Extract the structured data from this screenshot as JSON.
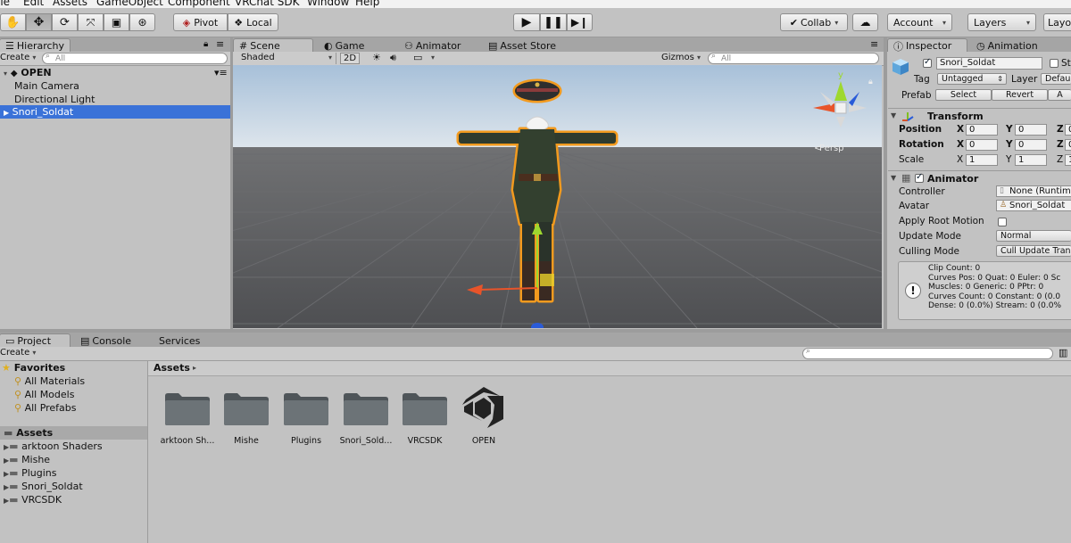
{
  "menu": [
    "ile",
    "Edit",
    "Assets",
    "GameObject",
    "Component",
    "VRChat SDK",
    "Window",
    "Help"
  ],
  "toolbar": {
    "pivot": "Pivot",
    "local": "Local",
    "collab": "Collab",
    "account": "Account",
    "layers": "Layers",
    "layout": "Layo"
  },
  "hierarchy": {
    "tab": "Hierarchy",
    "create": "Create",
    "search_placeholder": "All",
    "scene_name": "OPEN",
    "items": [
      "Main Camera",
      "Directional Light",
      "Snori_Soldat"
    ]
  },
  "scene_tabs": [
    "Scene",
    "Game",
    "Animator",
    "Asset Store"
  ],
  "scene_toolbar": {
    "shading": "Shaded",
    "mode_2d": "2D",
    "gizmos": "Gizmos",
    "search_placeholder": "All"
  },
  "scene_view": {
    "gizmo_y": "y",
    "persp": "Persp"
  },
  "inspector": {
    "tabs": [
      "Inspector",
      "Animation"
    ],
    "object_name": "Snori_Soldat",
    "static_label": "St",
    "tag_label": "Tag",
    "tag_value": "Untagged",
    "layer_label": "Layer",
    "layer_value": "Defau",
    "prefab_label": "Prefab",
    "prefab_buttons": [
      "Select",
      "Revert",
      "A"
    ],
    "transform": {
      "title": "Transform",
      "rows": [
        {
          "label": "Position",
          "x": "0",
          "y": "0",
          "z": "0"
        },
        {
          "label": "Rotation",
          "x": "0",
          "y": "0",
          "z": "0"
        },
        {
          "label": "Scale",
          "x": "1",
          "y": "1",
          "z": "1"
        }
      ]
    },
    "animator": {
      "title": "Animator",
      "controller_label": "Controller",
      "controller_value": "None (Runtim",
      "avatar_label": "Avatar",
      "avatar_value": "Snori_Soldat",
      "root_motion_label": "Apply Root Motion",
      "update_mode_label": "Update Mode",
      "update_mode_value": "Normal",
      "culling_label": "Culling Mode",
      "culling_value": "Cull Update Tran",
      "info": [
        "Clip Count: 0",
        "Curves Pos: 0 Quat: 0 Euler: 0 Sc",
        "Muscles: 0 Generic: 0 PPtr: 0",
        "Curves Count: 0 Constant: 0 (0.0",
        "Dense: 0 (0.0%) Stream: 0 (0.0%"
      ]
    }
  },
  "project": {
    "tabs": [
      "Project",
      "Console",
      "Services"
    ],
    "create": "Create",
    "favorites_label": "Favorites",
    "favorites": [
      "All Materials",
      "All Models",
      "All Prefabs"
    ],
    "assets_label": "Assets",
    "asset_folders": [
      "arktoon Shaders",
      "Mishe",
      "Plugins",
      "Snori_Soldat",
      "VRCSDK"
    ],
    "breadcrumb": "Assets",
    "grid_items": [
      "arktoon Sh...",
      "Mishe",
      "Plugins",
      "Snori_Sold...",
      "VRCSDK",
      "OPEN"
    ]
  },
  "colors": {
    "selection": "#3a72d8",
    "panel": "#c2c2c2",
    "outline": "#f29a1e",
    "sky": "#b9cde0",
    "ground": "#55565a"
  }
}
